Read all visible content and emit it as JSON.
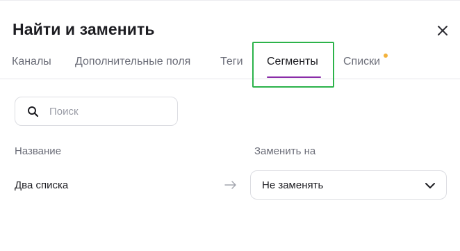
{
  "dialog": {
    "title": "Найти и заменить",
    "close_icon": "close-icon"
  },
  "tabs": [
    {
      "label": "Каналы",
      "active": false
    },
    {
      "label": "Дополнительные поля",
      "active": false
    },
    {
      "label": "Теги",
      "active": false
    },
    {
      "label": "Сегменты",
      "active": true
    },
    {
      "label": "Списки",
      "active": false,
      "has_notification": true
    }
  ],
  "search": {
    "placeholder": "Поиск",
    "value": "",
    "icon": "search-icon"
  },
  "table": {
    "headers": {
      "name": "Название",
      "replace_with": "Заменить на"
    },
    "rows": [
      {
        "name": "Два списка",
        "arrow_icon": "arrow-right-icon",
        "replace_value": "Не заменять",
        "dropdown_icon": "chevron-down-icon"
      }
    ]
  },
  "colors": {
    "active_tab_underline": "#8a2ca8",
    "highlight_box": "#2cb34a",
    "notification_dot": "#f3b23c"
  }
}
